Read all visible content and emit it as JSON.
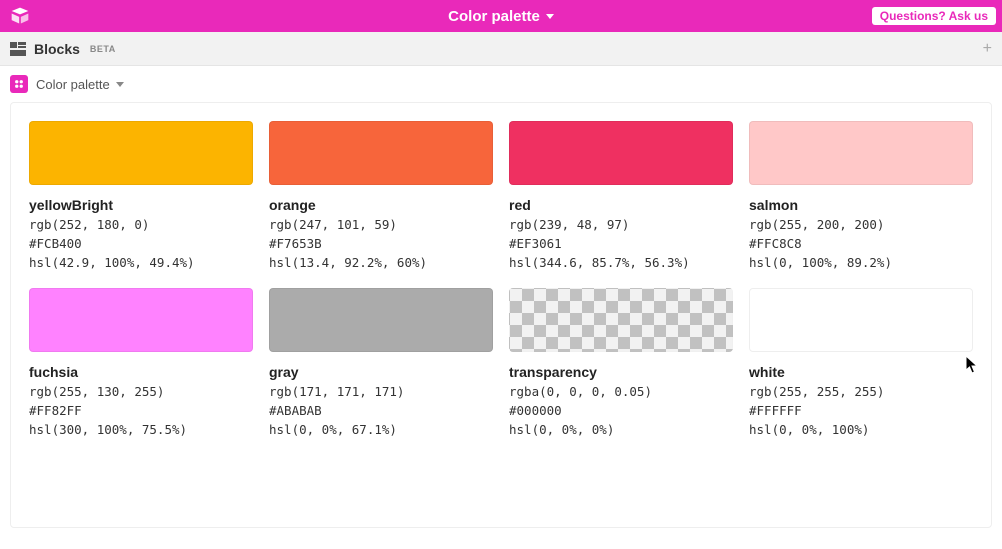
{
  "topbar": {
    "title": "Color palette",
    "ask_label": "Questions? Ask us"
  },
  "blocksbar": {
    "label": "Blocks",
    "beta": "BETA"
  },
  "breadcrumb": {
    "label": "Color palette"
  },
  "swatches": [
    {
      "name": "yellowBright",
      "rgb": "rgb(252, 180, 0)",
      "hex": "#FCB400",
      "hsl": "hsl(42.9, 100%, 49.4%)",
      "fill": "#FCB400",
      "kind": "solid"
    },
    {
      "name": "orange",
      "rgb": "rgb(247, 101, 59)",
      "hex": "#F7653B",
      "hsl": "hsl(13.4, 92.2%, 60%)",
      "fill": "#F7653B",
      "kind": "solid"
    },
    {
      "name": "red",
      "rgb": "rgb(239, 48, 97)",
      "hex": "#EF3061",
      "hsl": "hsl(344.6, 85.7%, 56.3%)",
      "fill": "#EF3061",
      "kind": "solid"
    },
    {
      "name": "salmon",
      "rgb": "rgb(255, 200, 200)",
      "hex": "#FFC8C8",
      "hsl": "hsl(0, 100%, 89.2%)",
      "fill": "#FFC8C8",
      "kind": "solid"
    },
    {
      "name": "fuchsia",
      "rgb": "rgb(255, 130, 255)",
      "hex": "#FF82FF",
      "hsl": "hsl(300, 100%, 75.5%)",
      "fill": "#FF82FF",
      "kind": "solid"
    },
    {
      "name": "gray",
      "rgb": "rgb(171, 171, 171)",
      "hex": "#ABABAB",
      "hsl": "hsl(0, 0%, 67.1%)",
      "fill": "#ABABAB",
      "kind": "solid"
    },
    {
      "name": "transparency",
      "rgb": "rgba(0, 0, 0, 0.05)",
      "hex": "#000000",
      "hsl": "hsl(0, 0%, 0%)",
      "fill": "",
      "kind": "checker"
    },
    {
      "name": "white",
      "rgb": "rgb(255, 255, 255)",
      "hex": "#FFFFFF",
      "hsl": "hsl(0, 0%, 100%)",
      "fill": "#FFFFFF",
      "kind": "white"
    }
  ]
}
